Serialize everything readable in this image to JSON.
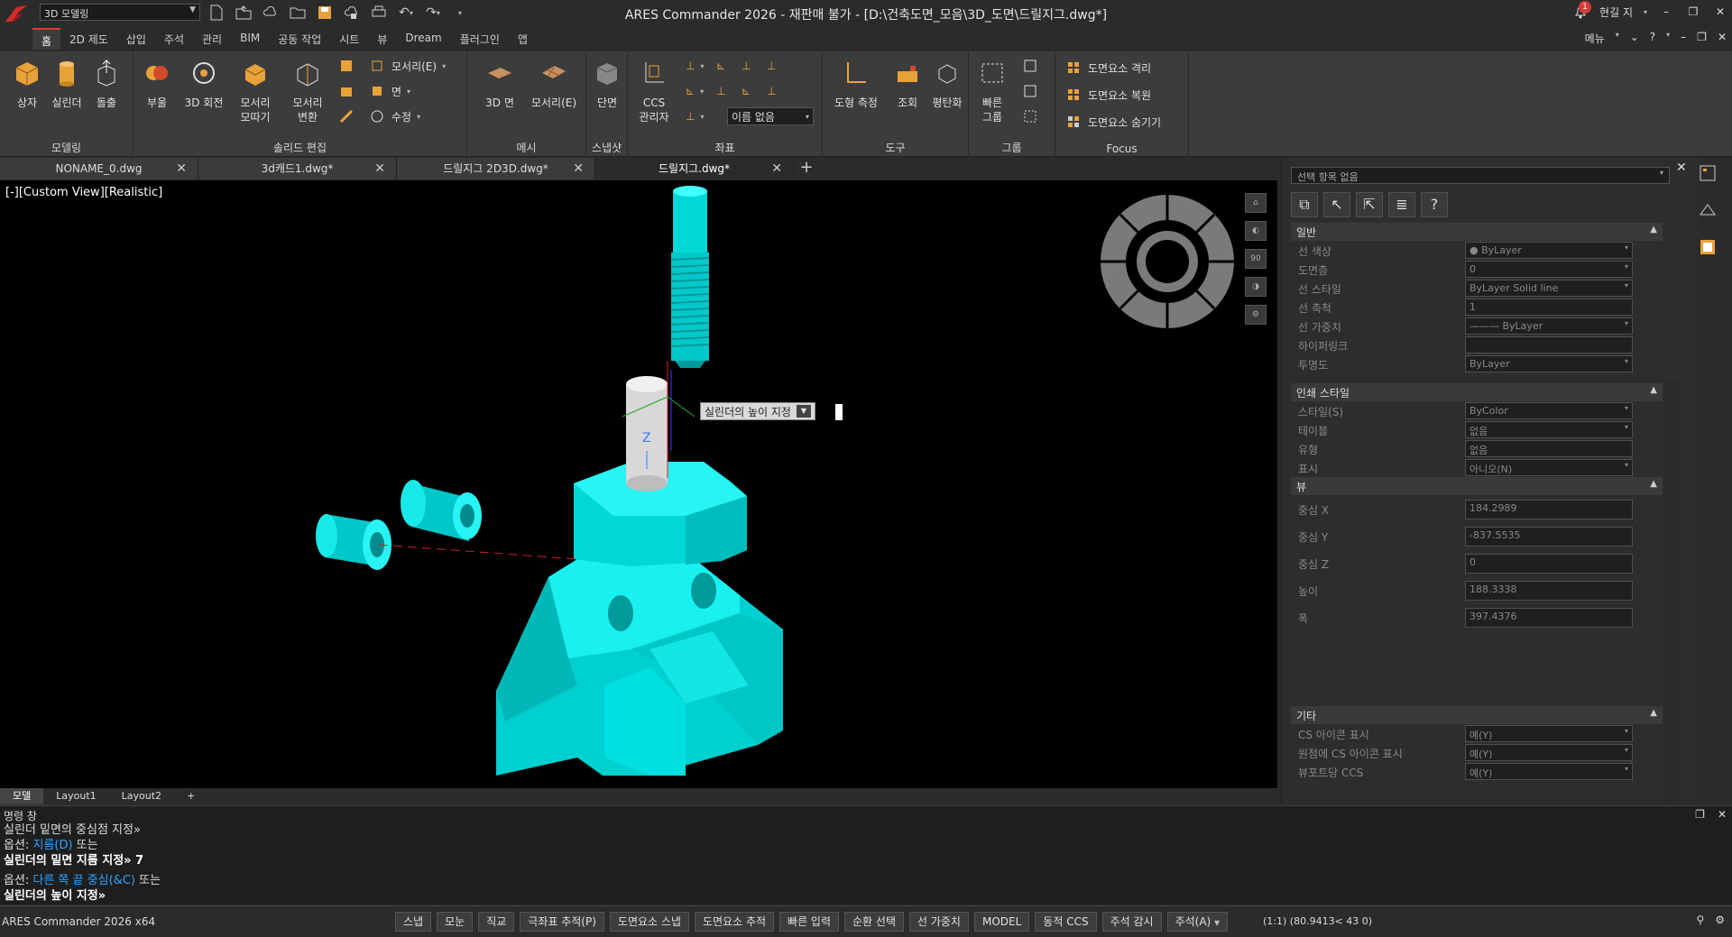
{
  "workspace": {
    "value": "3D 모델링"
  },
  "title": "ARES Commander 2026 - 재판매 불가 - [D:\\건축도면_모음\\3D_도면\\드릴지그.dwg*]",
  "titlebar_right": {
    "notif_count": "1",
    "user": "현길 지"
  },
  "ribbon_tabs": [
    "홈",
    "2D 제도",
    "삽입",
    "주석",
    "관리",
    "BIM",
    "공동 작업",
    "시트",
    "뷰",
    "Dream",
    "플러그인",
    "앱"
  ],
  "menu_right": {
    "menu": "메뉴",
    "help": "?"
  },
  "ribbon": {
    "modeling": {
      "title": "모델링",
      "box": "상자",
      "cylinder": "실린더",
      "extrude": "돌출"
    },
    "solid_edit": {
      "title": "솔리드 편집",
      "union": "부울",
      "revolve": "3D 회전",
      "fillet_l1": "모서리",
      "fillet_l2": "모따기",
      "edge_l1": "모서리",
      "edge_l2": "변환",
      "edge_dd": "모서리(E)",
      "face": "면",
      "modify": "수정"
    },
    "mesh": {
      "title": "메시",
      "face3d": "3D 면",
      "edge_e": "모서리(E)"
    },
    "snapshot": {
      "title": "스냅샷",
      "section": "단면"
    },
    "coords": {
      "title": "좌표",
      "ccs_l1": "CCS",
      "ccs_l2": "관리자",
      "name_none": "이름 없음"
    },
    "tools": {
      "title": "도구",
      "measure": "도형 측정",
      "lookup": "조회",
      "flatten": "평탄화"
    },
    "group": {
      "title": "그룹",
      "quick_l1": "빠른",
      "quick_l2": "그룹"
    },
    "focus": {
      "title": "Focus",
      "isolate": "도면요소 격리",
      "restore": "도면요소 복원",
      "hide": "도면요소 숨기기"
    }
  },
  "doc_tabs": [
    {
      "label": "NONAME_0.dwg"
    },
    {
      "label": "3d캐드1.dwg*"
    },
    {
      "label": "드릴지그 2D3D.dwg*"
    },
    {
      "label": "드릴지그.dwg*"
    }
  ],
  "viewport": {
    "label": "[-][Custom View][Realistic]",
    "tooltip": "실린더의 높이 지정",
    "nav_90": "90"
  },
  "layout_tabs": [
    "모델",
    "Layout1",
    "Layout2"
  ],
  "properties": {
    "selection": "선택 항목 없음",
    "sections": [
      {
        "title": "일반",
        "rows": [
          {
            "label": "선 색상",
            "value": "ByLayer"
          },
          {
            "label": "도면층",
            "value": "0"
          },
          {
            "label": "선 스타일",
            "value": "ByLayer     Solid line"
          },
          {
            "label": "선 축척",
            "value": "1"
          },
          {
            "label": "선 가중치",
            "value": "——— ByLayer"
          },
          {
            "label": "하이퍼링크",
            "value": ""
          },
          {
            "label": "투명도",
            "value": "ByLayer"
          }
        ]
      },
      {
        "title": "인쇄 스타일",
        "rows": [
          {
            "label": "스타일(S)",
            "value": "ByColor"
          },
          {
            "label": "테이블",
            "value": "없음"
          },
          {
            "label": "유형",
            "value": "없음"
          },
          {
            "label": "표시",
            "value": "아니오(N)"
          }
        ]
      },
      {
        "title": "뷰",
        "rows": [
          {
            "label": "중심 X",
            "value": "184.2989"
          },
          {
            "label": "중심 Y",
            "value": "-837.5535"
          },
          {
            "label": "중심 Z",
            "value": "0"
          },
          {
            "label": "높이",
            "value": "188.3338"
          },
          {
            "label": "폭",
            "value": "397.4376"
          }
        ]
      },
      {
        "title": "기타",
        "rows": [
          {
            "label": "CS 아이콘 표시",
            "value": "예(Y)"
          },
          {
            "label": "원점에 CS 아이콘 표시",
            "value": "예(Y)"
          },
          {
            "label": "뷰포트당 CCS",
            "value": "예(Y)"
          }
        ]
      }
    ]
  },
  "command": {
    "title": "명령 창",
    "line1": "실린더 밑면의 중심점 지정»",
    "line2_prefix": "옵션:",
    "line2_opt": "지름(D)",
    "line2_suffix": "또는",
    "line3": "실린더의 밑면 지름 지정» 7",
    "line4_prefix": "옵션:",
    "line4_opt": "다른 쪽 끝 중심(&C)",
    "line4_suffix": "또는",
    "line5": "실린더의 높이 지정»"
  },
  "status": {
    "app": "ARES Commander 2026 x64",
    "buttons": [
      "스냅",
      "모눈",
      "직교",
      "극좌표 추적(P)",
      "도면요소 스냅",
      "도면요소 추적",
      "빠른 입력",
      "순환 선택",
      "선 가중치",
      "MODEL",
      "동적 CCS",
      "주석 감시",
      "주석(A)"
    ],
    "coords": "(1:1)  (80.9413< 43 0)"
  },
  "colors": {
    "accent": "#e03b3b",
    "model": "#00e5e5",
    "link": "#2aa4ff"
  }
}
